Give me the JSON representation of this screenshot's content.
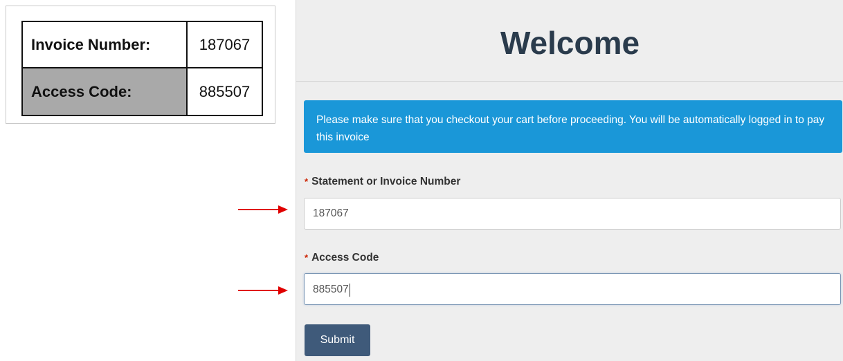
{
  "invoice_card": {
    "rows": [
      {
        "label": "Invoice Number:",
        "value": "187067"
      },
      {
        "label": "Access Code:",
        "value": "885507"
      }
    ]
  },
  "form": {
    "title": "Welcome",
    "notice": "Please make sure that you checkout your cart before proceeding. You will be automatically logged in to pay this invoice",
    "required_marker": "*",
    "invoice_field": {
      "label": "Statement or Invoice Number",
      "value": "187067"
    },
    "access_field": {
      "label": "Access Code",
      "value": "885507"
    },
    "submit_label": "Submit"
  },
  "colors": {
    "notice_bg": "#1a97d8",
    "submit_bg": "#3f5a7a",
    "title": "#2a3b4c",
    "arrow": "#e00000",
    "required": "#cc2200"
  },
  "annotations": {
    "arrow_icon": "right-arrow-icon"
  }
}
